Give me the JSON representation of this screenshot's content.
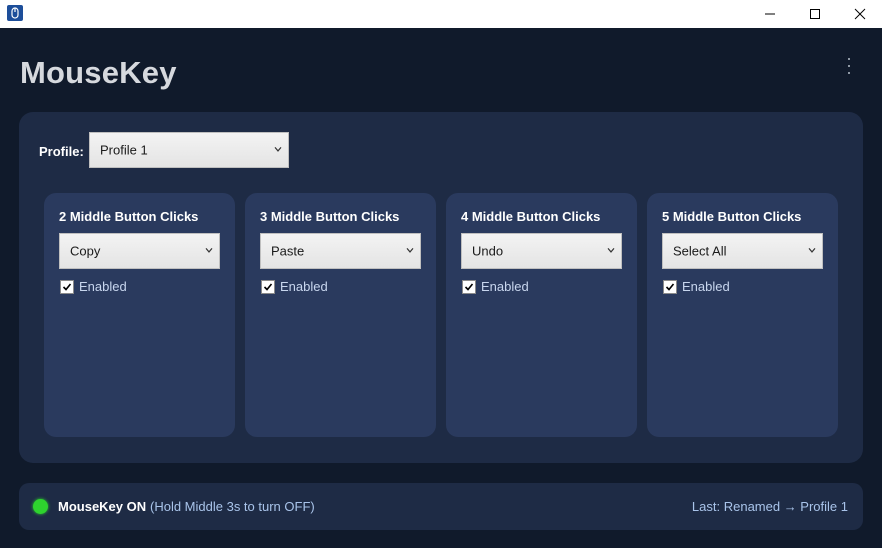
{
  "window": {
    "icon": "mouse-app-icon",
    "controls": [
      "minimize-icon",
      "maximize-icon",
      "close-icon"
    ]
  },
  "header": {
    "title": "MouseKey",
    "menu_icon": "more-vertical-icon"
  },
  "profile": {
    "label": "Profile:",
    "selected": "Profile 1"
  },
  "cards": [
    {
      "title": "2 Middle Button Clicks",
      "action": "Copy",
      "enabled_label": "Enabled",
      "enabled": true
    },
    {
      "title": "3 Middle Button Clicks",
      "action": "Paste",
      "enabled_label": "Enabled",
      "enabled": true
    },
    {
      "title": "4 Middle Button Clicks",
      "action": "Undo",
      "enabled_label": "Enabled",
      "enabled": true
    },
    {
      "title": "5 Middle Button Clicks",
      "action": "Select All",
      "enabled_label": "Enabled",
      "enabled": true
    }
  ],
  "status": {
    "state": "MouseKey ON",
    "hint": "(Hold Middle 3s to turn OFF)",
    "last": "Last: Renamed → Profile 1",
    "indicator_color": "#2ed32e"
  },
  "colors": {
    "background": "#101a2b",
    "panel": "#1e2b45",
    "card": "#2a3a5e",
    "accent_text": "#a9c4ea"
  }
}
